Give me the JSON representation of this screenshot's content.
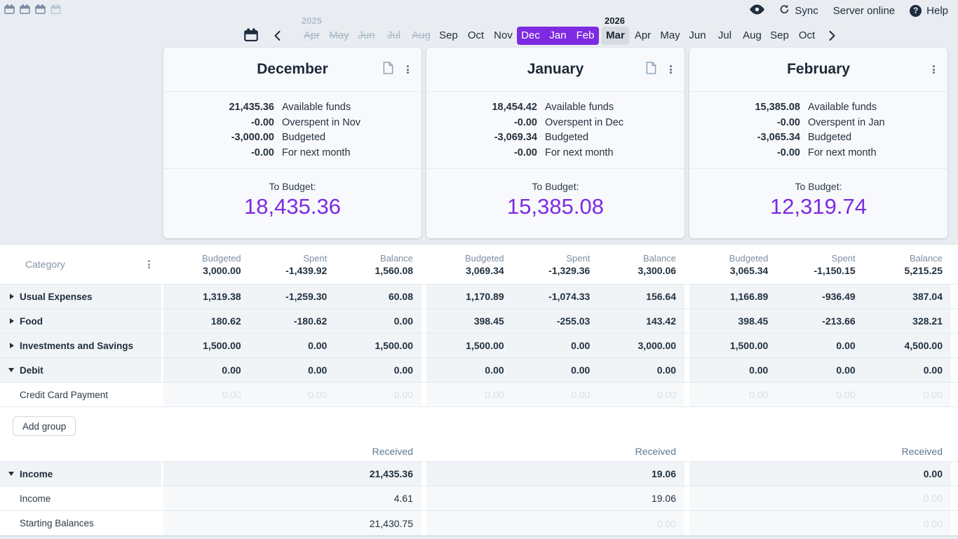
{
  "colors": {
    "accent_purple": "#7e2ae2",
    "navy": "#1f2c3e",
    "page_bg": "#e9edf1"
  },
  "topbar": {
    "view_toggles": [
      {
        "name": "show-1-month"
      },
      {
        "name": "show-2-months"
      },
      {
        "name": "show-3-months"
      },
      {
        "name": "show-4-months"
      }
    ],
    "sync_label": "Sync",
    "server_status": "Server online",
    "help_label": "Help"
  },
  "month_nav": {
    "year_2025": "2025",
    "year_2026": "2026",
    "months": [
      {
        "label": "Apr",
        "state": "disabled"
      },
      {
        "label": "May",
        "state": "disabled"
      },
      {
        "label": "Jun",
        "state": "disabled"
      },
      {
        "label": "Jul",
        "state": "disabled"
      },
      {
        "label": "Aug",
        "state": "disabled"
      },
      {
        "label": "Sep",
        "state": "normal"
      },
      {
        "label": "Oct",
        "state": "normal"
      },
      {
        "label": "Nov",
        "state": "normal"
      },
      {
        "label": "Dec",
        "state": "selected"
      },
      {
        "label": "Jan",
        "state": "selected"
      },
      {
        "label": "Feb",
        "state": "selected"
      },
      {
        "label": "Mar",
        "state": "current"
      },
      {
        "label": "Apr",
        "state": "normal"
      },
      {
        "label": "May",
        "state": "normal"
      },
      {
        "label": "Jun",
        "state": "normal"
      },
      {
        "label": "Jul",
        "state": "normal"
      },
      {
        "label": "Aug",
        "state": "normal"
      },
      {
        "label": "Sep",
        "state": "normal"
      },
      {
        "label": "Oct",
        "state": "normal"
      }
    ]
  },
  "cards": [
    {
      "title": "December",
      "stats": [
        {
          "value": "21,435.36",
          "label": "Available funds"
        },
        {
          "value": "-0.00",
          "label": "Overspent in Nov"
        },
        {
          "value": "-3,000.00",
          "label": "Budgeted"
        },
        {
          "value": "-0.00",
          "label": "For next month"
        }
      ],
      "to_budget_label": "To Budget:",
      "to_budget_value": "18,435.36"
    },
    {
      "title": "January",
      "stats": [
        {
          "value": "18,454.42",
          "label": "Available funds"
        },
        {
          "value": "-0.00",
          "label": "Overspent in Dec"
        },
        {
          "value": "-3,069.34",
          "label": "Budgeted"
        },
        {
          "value": "-0.00",
          "label": "For next month"
        }
      ],
      "to_budget_label": "To Budget:",
      "to_budget_value": "15,385.08"
    },
    {
      "title": "February",
      "stats": [
        {
          "value": "15,385.08",
          "label": "Available funds"
        },
        {
          "value": "-0.00",
          "label": "Overspent in Jan"
        },
        {
          "value": "-3,065.34",
          "label": "Budgeted"
        },
        {
          "value": "-0.00",
          "label": "For next month"
        }
      ],
      "to_budget_label": "To Budget:",
      "to_budget_value": "12,319.74"
    }
  ],
  "table": {
    "category_header": "Category",
    "column_labels": [
      "Budgeted",
      "Spent",
      "Balance"
    ],
    "totals": [
      [
        "3,000.00",
        "-1,439.92",
        "1,560.08"
      ],
      [
        "3,069.34",
        "-1,329.36",
        "3,300.06"
      ],
      [
        "3,065.34",
        "-1,150.15",
        "5,215.25"
      ]
    ],
    "rows": [
      {
        "name": "Usual Expenses",
        "type": "group-collapsed",
        "months": [
          [
            "1,319.38",
            "-1,259.30",
            "60.08"
          ],
          [
            "1,170.89",
            "-1,074.33",
            "156.64"
          ],
          [
            "1,166.89",
            "-936.49",
            "387.04"
          ]
        ]
      },
      {
        "name": "Food",
        "type": "group-collapsed",
        "months": [
          [
            "180.62",
            "-180.62",
            "0.00"
          ],
          [
            "398.45",
            "-255.03",
            "143.42"
          ],
          [
            "398.45",
            "-213.66",
            "328.21"
          ]
        ]
      },
      {
        "name": "Investments and Savings",
        "type": "group-collapsed",
        "months": [
          [
            "1,500.00",
            "0.00",
            "1,500.00"
          ],
          [
            "1,500.00",
            "0.00",
            "3,000.00"
          ],
          [
            "1,500.00",
            "0.00",
            "4,500.00"
          ]
        ]
      },
      {
        "name": "Debit",
        "type": "group-expanded",
        "months": [
          [
            "0.00",
            "0.00",
            "0.00"
          ],
          [
            "0.00",
            "0.00",
            "0.00"
          ],
          [
            "0.00",
            "0.00",
            "0.00"
          ]
        ]
      },
      {
        "name": "Credit Card Payment",
        "type": "category",
        "months": [
          [
            "0.00",
            "0.00",
            "0.00"
          ],
          [
            "0.00",
            "0.00",
            "0.00"
          ],
          [
            "0.00",
            "0.00",
            "0.00"
          ]
        ]
      }
    ],
    "add_group_label": "Add group",
    "received_label": "Received",
    "income_rows": [
      {
        "name": "Income",
        "type": "group-expanded",
        "values": [
          "21,435.36",
          "19.06",
          "0.00"
        ]
      },
      {
        "name": "Income",
        "type": "category",
        "values": [
          "4.61",
          "19.06",
          "0.00"
        ]
      },
      {
        "name": "Starting Balances",
        "type": "category",
        "values": [
          "21,430.75",
          "0.00",
          "0.00"
        ]
      }
    ]
  }
}
